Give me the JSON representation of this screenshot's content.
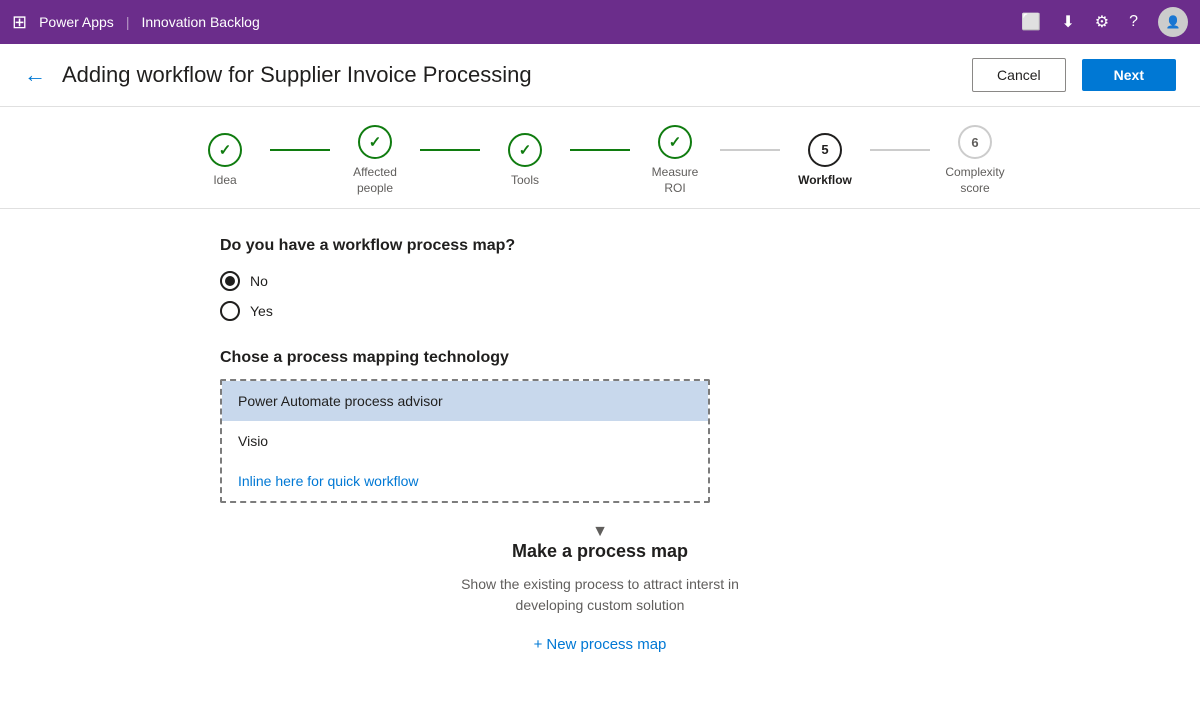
{
  "topbar": {
    "app_name": "Power Apps",
    "separator": "|",
    "section_name": "Innovation Backlog"
  },
  "header": {
    "title": "Adding workflow for Supplier Invoice Processing",
    "cancel_label": "Cancel",
    "next_label": "Next"
  },
  "stepper": {
    "steps": [
      {
        "id": "idea",
        "label": "Idea",
        "state": "completed",
        "number": "✓"
      },
      {
        "id": "affected-people",
        "label": "Affected\npeople",
        "state": "completed",
        "number": "✓"
      },
      {
        "id": "tools",
        "label": "Tools",
        "state": "completed",
        "number": "✓"
      },
      {
        "id": "measure-roi",
        "label": "Measure\nROI",
        "state": "completed",
        "number": "✓"
      },
      {
        "id": "workflow",
        "label": "Workflow",
        "state": "active",
        "number": "5"
      },
      {
        "id": "complexity-score",
        "label": "Complexity\nscore",
        "state": "inactive",
        "number": "6"
      }
    ]
  },
  "workflow_question": {
    "label": "Do you have a workflow process map?",
    "options": [
      {
        "value": "no",
        "label": "No",
        "selected": true
      },
      {
        "value": "yes",
        "label": "Yes",
        "selected": false
      }
    ]
  },
  "process_technology": {
    "section_title": "Chose a process mapping technology",
    "options": [
      {
        "value": "power-automate",
        "label": "Power Automate process advisor",
        "selected": true
      },
      {
        "value": "visio",
        "label": "Visio",
        "selected": false
      },
      {
        "value": "inline",
        "label": "Inline here for quick workflow",
        "selected": false,
        "is_link": true
      }
    ]
  },
  "process_map": {
    "title": "Make a process map",
    "description": "Show the existing process to attract interst in\ndeveloping custom solution",
    "new_link_icon": "+",
    "new_link_label": "New process map"
  }
}
